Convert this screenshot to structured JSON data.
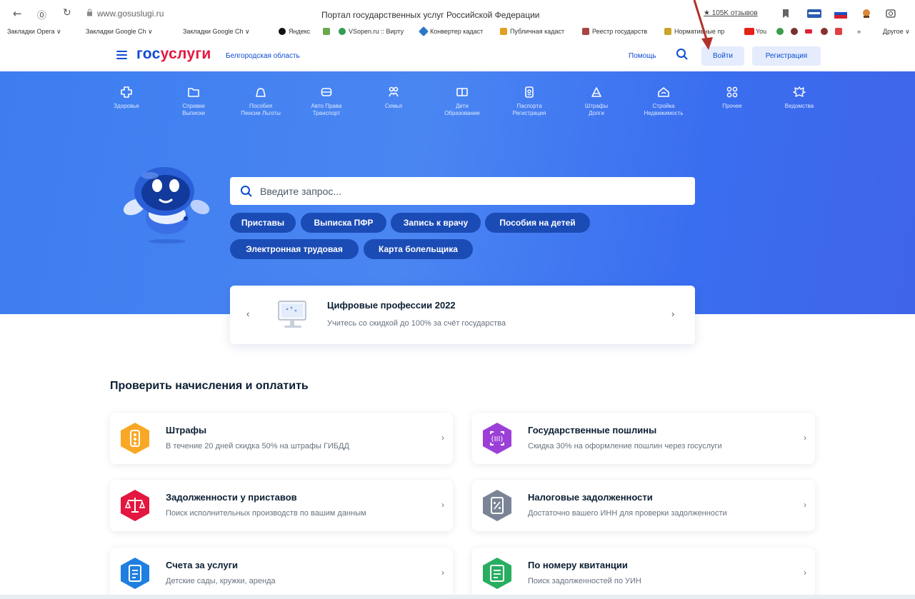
{
  "browser": {
    "url": "www.gosuslugi.ru",
    "tab_title": "Портал государственных услуг Российской Федерации",
    "reviews_label": "★ 105K отзывов",
    "bookmarks": [
      "Закладки Opera ∨",
      "Закладки Google Ch ∨",
      "Закладки Google Ch ∨",
      "Яндекс",
      "VSopen.ru :: Вирту",
      "Конвертер кадаст",
      "Публичная кадаст",
      "Реестр государств",
      "Нормативные пр",
      "You",
      "»",
      "Другое ∨"
    ]
  },
  "header": {
    "logo_part1": "гос",
    "logo_part2": "услуги",
    "region": "Белгородская область",
    "help": "Помощь",
    "login": "Войти",
    "register": "Регистрация"
  },
  "categories": [
    {
      "l1": "Здоровье",
      "l2": "",
      "icon": "health-icon"
    },
    {
      "l1": "Справки",
      "l2": "Выписки",
      "icon": "folder-icon"
    },
    {
      "l1": "Пособия",
      "l2": "Пенсии Льготы",
      "icon": "benefits-icon"
    },
    {
      "l1": "Авто Права",
      "l2": "Транспорт",
      "icon": "car-icon"
    },
    {
      "l1": "Семья",
      "l2": "",
      "icon": "family-icon"
    },
    {
      "l1": "Дети",
      "l2": "Образование",
      "icon": "book-icon"
    },
    {
      "l1": "Паспорта",
      "l2": "Регистрация",
      "icon": "passport-icon"
    },
    {
      "l1": "Штрафы",
      "l2": "Долги",
      "icon": "fines-icon"
    },
    {
      "l1": "Стройка",
      "l2": "Недвижимость",
      "icon": "house-icon"
    },
    {
      "l1": "Прочее",
      "l2": "",
      "icon": "grid-icon"
    },
    {
      "l1": "Ведомства",
      "l2": "",
      "icon": "emblem-icon"
    }
  ],
  "search": {
    "placeholder": "Введите запрос..."
  },
  "chips": [
    "Приставы",
    "Выписка ПФР",
    "Запись к врачу",
    "Пособия на детей",
    "Электронная трудовая",
    "Карта болельщика"
  ],
  "promo": {
    "prev": "‹",
    "next": "›",
    "title": "Цифровые профессии 2022",
    "subtitle": "Учитесь со скидкой до 100% за счёт государства"
  },
  "section": {
    "title": "Проверить начисления и оплатить"
  },
  "cards": [
    {
      "title": "Штрафы",
      "subtitle": "В течение 20 дней скидка 50% на штрафы ГИБДД",
      "color": "#f9a825",
      "icon": "traffic-light-icon"
    },
    {
      "title": "Государственные пошлины",
      "subtitle": "Скидка 30% на оформление пошлин через госуслуги",
      "color": "#9c3fd8",
      "icon": "duty-icon"
    },
    {
      "title": "Задолженности у приставов",
      "subtitle": "Поиск исполнительных производств по вашим данным",
      "color": "#e3173f",
      "icon": "scales-icon"
    },
    {
      "title": "Налоговые задолженности",
      "subtitle": "Достаточно вашего ИНН для проверки задолженности",
      "color": "#7a8496",
      "icon": "tax-icon"
    },
    {
      "title": "Счета за услуги",
      "subtitle": "Детские сады, кружки, аренда",
      "color": "#1f7fe0",
      "icon": "bill-icon"
    },
    {
      "title": "По номеру квитанции",
      "subtitle": "Поиск задолженностей по УИН",
      "color": "#27ae60",
      "icon": "receipt-icon"
    }
  ],
  "colors": {
    "primary": "#0d4cd3",
    "accent_red": "#e3173f",
    "hero_blue": "#4a86f2",
    "chip_blue": "#1b4bb5"
  }
}
